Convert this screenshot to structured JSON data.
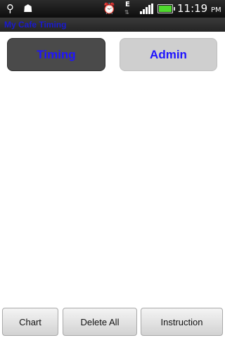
{
  "status_bar": {
    "icons": [
      "usb-icon",
      "debug-icon",
      "alarm-icon",
      "network-e-icon",
      "signal-icon",
      "battery-icon"
    ],
    "network_label": "E",
    "time": "11:19",
    "ampm": "PM",
    "battery_color": "#4fd92e"
  },
  "app": {
    "title": "My Cafe Timing",
    "title_color": "#1a1ad0"
  },
  "top_buttons": {
    "timing_label": "Timing",
    "admin_label": "Admin",
    "label_color": "#1f14ff"
  },
  "bottom_buttons": {
    "chart_label": "Chart",
    "delete_all_label": "Delete All",
    "instruction_label": "Instruction"
  }
}
